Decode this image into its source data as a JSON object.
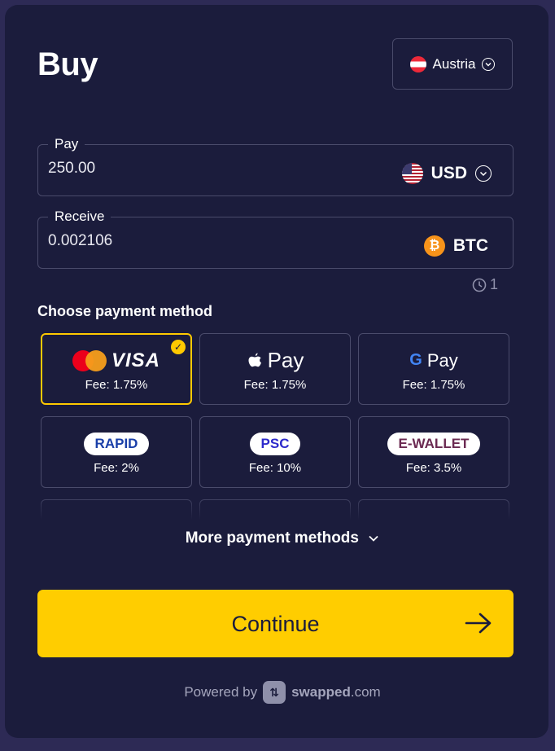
{
  "header": {
    "title": "Buy"
  },
  "country": {
    "name": "Austria",
    "icon": "austria-flag-icon"
  },
  "pay": {
    "label": "Pay",
    "value": "250.00",
    "currency": "USD",
    "icon": "us-flag-icon"
  },
  "receive": {
    "label": "Receive",
    "value": "0.002106",
    "currency": "BTC",
    "icon": "bitcoin-icon"
  },
  "timer": {
    "value": "1",
    "icon": "clock-icon"
  },
  "payment": {
    "title": "Choose payment method",
    "methods": [
      {
        "name": "VISA",
        "fee": "Fee: 1.75%",
        "selected": true
      },
      {
        "name": "Pay",
        "fee": "Fee: 1.75%",
        "selected": false
      },
      {
        "name": "Pay",
        "g": "G",
        "fee": "Fee: 1.75%",
        "selected": false
      },
      {
        "name": "RAPID",
        "fee": "Fee: 2%",
        "color": "#1a3fa8",
        "selected": false
      },
      {
        "name": "PSC",
        "fee": "Fee: 10%",
        "color": "#2d2acb",
        "selected": false
      },
      {
        "name": "E-WALLET",
        "fee": "Fee: 3.5%",
        "color": "#6b2a52",
        "selected": false
      }
    ],
    "more_label": "More payment methods"
  },
  "continue": {
    "label": "Continue"
  },
  "footer": {
    "powered_by": "Powered by",
    "brand": "swapped",
    "brand_suffix": ".com"
  },
  "colors": {
    "background": "#1b1c3c",
    "accent": "#ffcd00",
    "border": "#4a4b6b"
  }
}
